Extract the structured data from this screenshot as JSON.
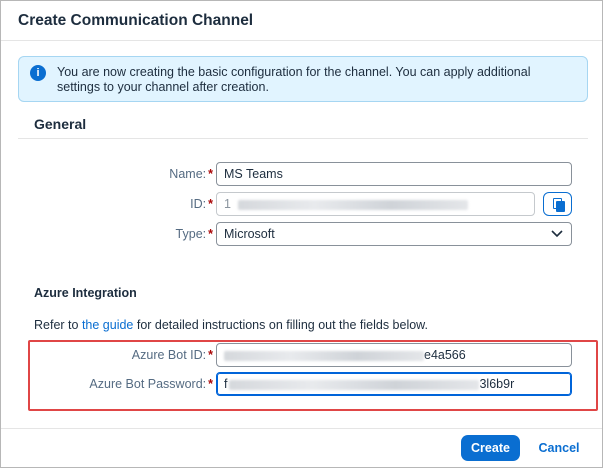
{
  "dialog": {
    "title": "Create Communication Channel"
  },
  "message_strip": {
    "icon": "info-icon",
    "text": "You are now creating the basic configuration for the channel. You can apply additional settings to your channel after creation."
  },
  "general": {
    "title": "General",
    "name_label": "Name:",
    "name_value": "MS Teams",
    "id_label": "ID:",
    "id_value": "1",
    "copy_icon": "copy-icon",
    "type_label": "Type:",
    "type_value": "Microsoft",
    "required_marker": "*"
  },
  "azure": {
    "title": "Azure Integration",
    "refer_prefix": "Refer to ",
    "refer_link": "the guide",
    "refer_suffix": " for detailed instructions on filling out the fields below.",
    "bot_id_label": "Azure Bot ID:",
    "bot_id_visible_suffix": "e4a566",
    "bot_password_label": "Azure Bot Password:",
    "bot_password_visible_prefix": "f",
    "bot_password_visible_suffix": "3l6b9r"
  },
  "footer": {
    "create_label": "Create",
    "cancel_label": "Cancel"
  },
  "colors": {
    "accent": "#0a6ed1",
    "info_strip_bg": "#e1f4ff",
    "required": "#aa0808",
    "highlight_box": "#e04646"
  }
}
